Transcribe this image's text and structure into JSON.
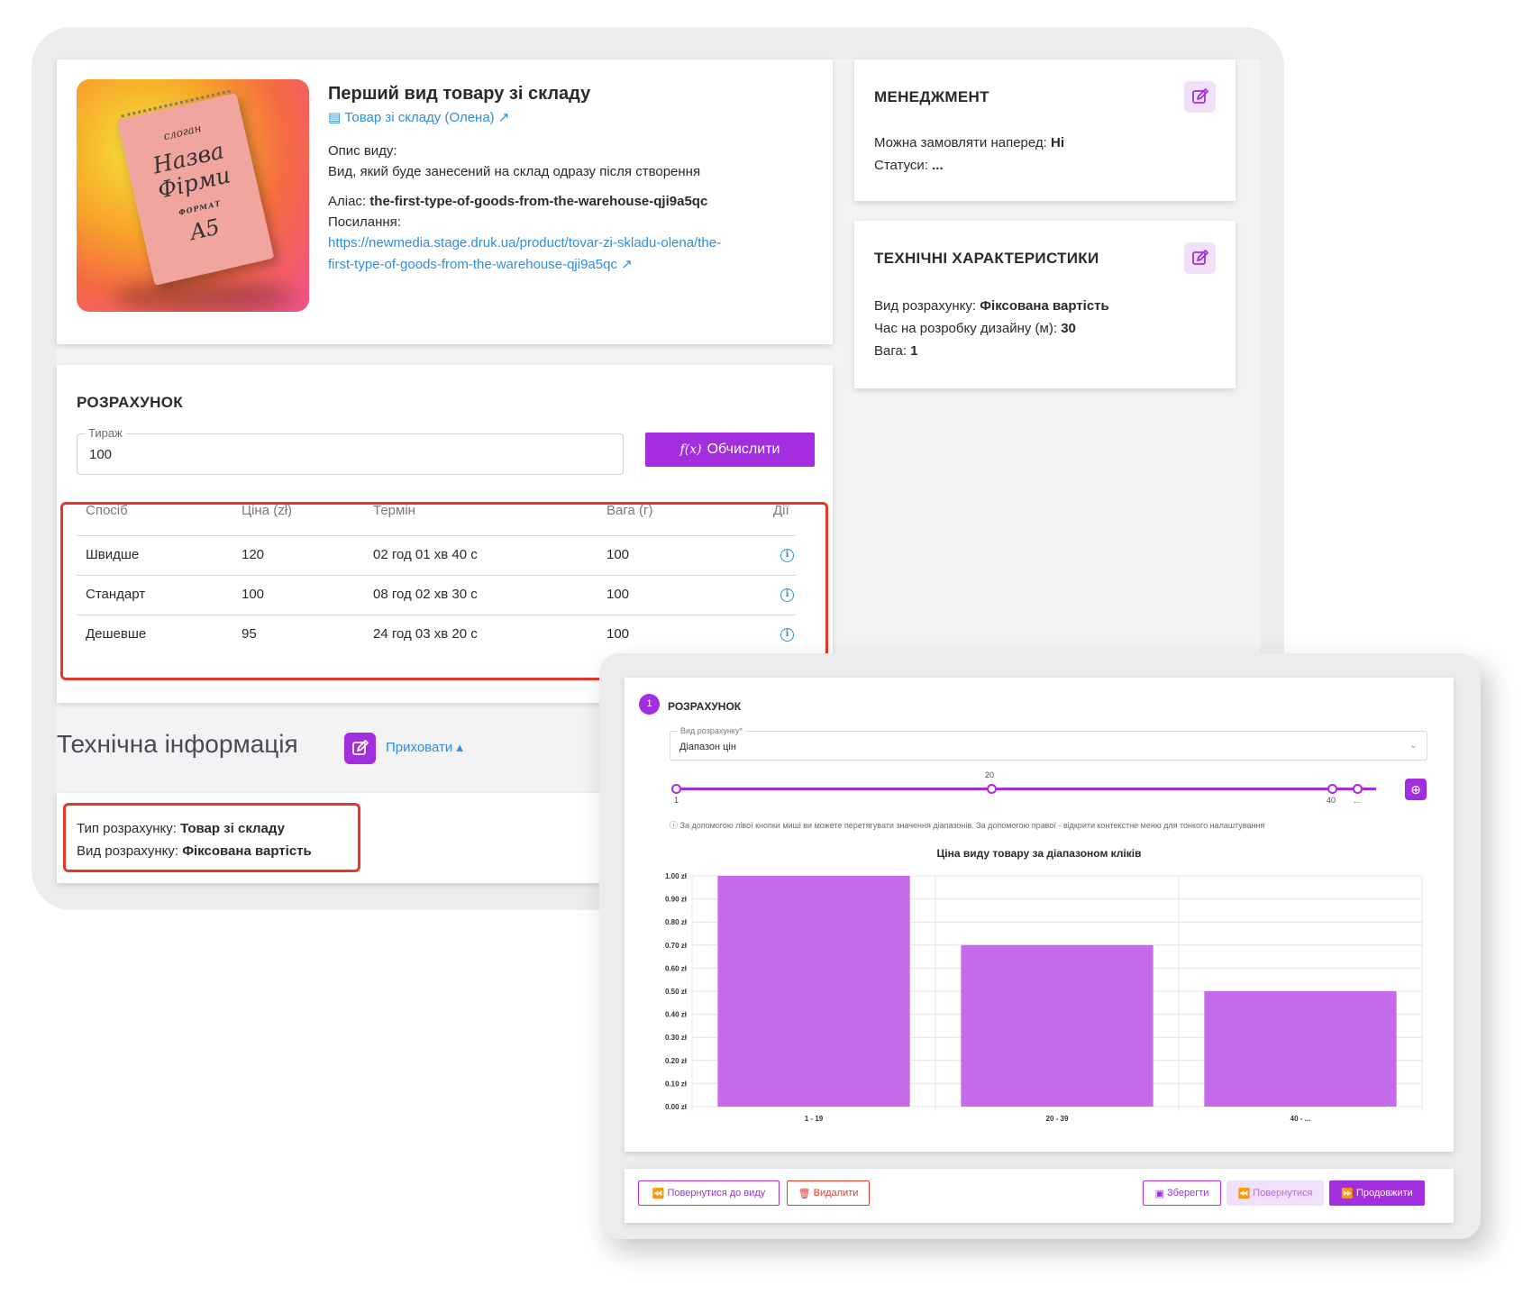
{
  "product": {
    "title": "Перший вид товару зі складу",
    "link_text": "Товар зі складу (Олена)",
    "desc_label": "Опис виду:",
    "desc_text": "Вид, який буде занесений на склад одразу після створення",
    "alias_label": "Аліас:",
    "alias_value": "the-first-type-of-goods-from-the-warehouse-qji9a5qc",
    "url_label": "Посилання:",
    "url_line1": "https://newmedia.stage.druk.ua/product/tovar-zi-skladu-olena/the-",
    "url_line2": "first-type-of-goods-from-the-warehouse-qji9a5qc",
    "image_text": {
      "slogan": "слоган",
      "name1": "Назва",
      "name2": "Фірми",
      "format": "ФОРМАТ",
      "size": "A5"
    }
  },
  "calc": {
    "title": "РОЗРАХУНОК",
    "tirazh_label": "Тираж",
    "tirazh_value": "100",
    "fx": "f(x)",
    "button_label": "Обчислити",
    "columns": [
      "Спосіб",
      "Ціна (zł)",
      "Термін",
      "Вага (г)",
      "Дії"
    ],
    "rows": [
      {
        "method": "Швидше",
        "price": "120",
        "term": "02 год 01 хв 40 с",
        "weight": "100"
      },
      {
        "method": "Стандарт",
        "price": "100",
        "term": "08 год 02 хв 30 с",
        "weight": "100"
      },
      {
        "method": "Дешевше",
        "price": "95",
        "term": "24 год 03 хв 20 с",
        "weight": "100"
      }
    ]
  },
  "tech_info": {
    "heading": "Технічна інформація",
    "hide_label": "Приховати",
    "type_label": "Тип розрахунку:",
    "type_value": "Товар зі складу",
    "kind_label": "Вид розрахунку:",
    "kind_value": "Фіксована вартість"
  },
  "management": {
    "title": "МЕНЕДЖМЕНТ",
    "preorder_label": "Можна замовляти наперед:",
    "preorder_value": "Ні",
    "statuses_label": "Статуси:",
    "statuses_value": "..."
  },
  "specs": {
    "title": "ТЕХНІЧНІ ХАРАКТЕРИСТИКИ",
    "calc_kind_label": "Вид розрахунку:",
    "calc_kind_value": "Фіксована вартість",
    "design_time_label": "Час на розробку дизайну (м):",
    "design_time_value": "30",
    "weight_label": "Вага:",
    "weight_value": "1"
  },
  "front": {
    "step": "1",
    "title": "РОЗРАХУНОК",
    "calc_type_label": "Вид розрахунку*",
    "calc_type_value": "Діапазон цін",
    "slider_labels": {
      "start": "1",
      "mid": "20",
      "end": "40",
      "more": "..."
    },
    "hint": "За допомогою лівої кнопки миші ви можете перетягувати значення діапазонів. За допомогою правої - відкрити контекстне меню для тонкого налаштування",
    "buttons": {
      "back_to_kind": "Повернутися до виду",
      "delete": "Видалити",
      "save": "Зберегти",
      "back": "Повернутися",
      "continue": "Продовжити"
    }
  },
  "chart_data": {
    "type": "bar",
    "title": "Ціна виду товару за діапазоном кліків",
    "categories": [
      "1 - 19",
      "20 - 39",
      "40 - ..."
    ],
    "values": [
      1.0,
      0.7,
      0.5
    ],
    "ylim": [
      0,
      1.0
    ],
    "yticks": [
      "0.00 zł",
      "0.10 zł",
      "0.20 zł",
      "0.30 zł",
      "0.40 zł",
      "0.50 zł",
      "0.60 zł",
      "0.70 zł",
      "0.80 zł",
      "0.90 zł",
      "1.00 zł"
    ],
    "grid": true,
    "bar_color": "#c56ae8"
  },
  "colors": {
    "accent": "#a22ee0",
    "link": "#2f8de0",
    "highlight": "#e53628"
  }
}
